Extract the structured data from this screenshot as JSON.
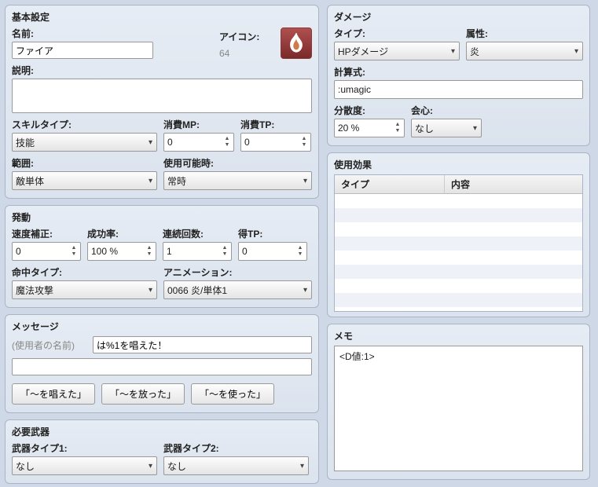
{
  "basic": {
    "title": "基本設定",
    "name_label": "名前:",
    "name": "ファイア",
    "icon_label": "アイコン:",
    "icon_index": "64",
    "desc_label": "説明:",
    "desc": "",
    "skill_type_label": "スキルタイプ:",
    "skill_type": "技能",
    "mp_label": "消費MP:",
    "mp": "0",
    "tp_label": "消費TP:",
    "tp": "0",
    "scope_label": "範囲:",
    "scope": "敵単体",
    "occasion_label": "使用可能時:",
    "occasion": "常時"
  },
  "invoke": {
    "title": "発動",
    "speed_label": "速度補正:",
    "speed": "0",
    "success_label": "成功率:",
    "success": "100 %",
    "repeat_label": "連続回数:",
    "repeat": "1",
    "gain_tp_label": "得TP:",
    "gain_tp": "0",
    "hit_type_label": "命中タイプ:",
    "hit_type": "魔法攻撃",
    "anim_label": "アニメーション:",
    "anim": "0066 炎/単体1"
  },
  "message": {
    "title": "メッセージ",
    "user_hint": "(使用者の名前)",
    "line1": "は%1を唱えた！",
    "line2": "",
    "btn1": "「～を唱えた」",
    "btn2": "「～を放った」",
    "btn3": "「～を使った」"
  },
  "req_weapon": {
    "title": "必要武器",
    "wt1_label": "武器タイプ1:",
    "wt1": "なし",
    "wt2_label": "武器タイプ2:",
    "wt2": "なし"
  },
  "damage": {
    "title": "ダメージ",
    "type_label": "タイプ:",
    "type": "HPダメージ",
    "element_label": "属性:",
    "element": "炎",
    "formula_label": "計算式:",
    "formula": ":umagic",
    "variance_label": "分散度:",
    "variance": "20 %",
    "crit_label": "会心:",
    "crit": "なし"
  },
  "effects": {
    "title": "使用効果",
    "col_type": "タイプ",
    "col_content": "内容"
  },
  "memo": {
    "title": "メモ",
    "text": "<D値:1>"
  }
}
